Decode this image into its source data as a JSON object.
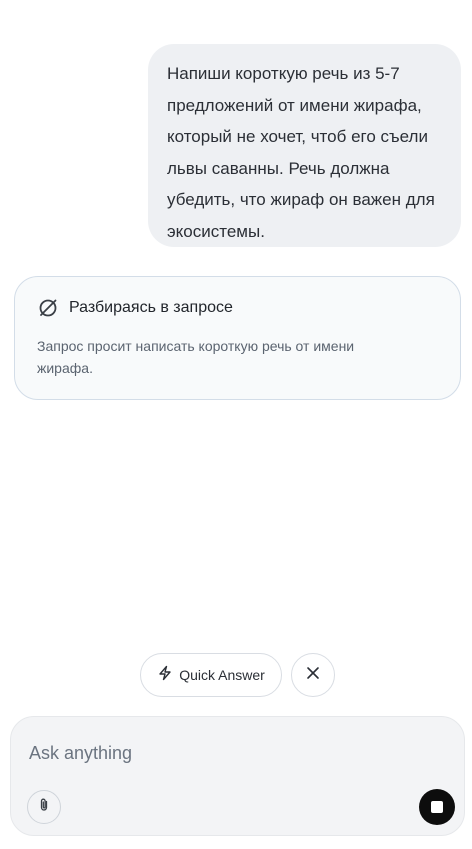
{
  "chat": {
    "user_message": "Напиши короткую речь из 5-7\nпредложений от имени жирафа,\nкоторый не хочет, чтоб его съели\nльвы саванны. Речь должна\nубедить, что жираф он важен для\nэкосистемы."
  },
  "reasoning": {
    "icon": "slashed-circle-icon",
    "title": "Разбираясь в запросе",
    "text": "Запрос просит написать короткую речь от имени\nжирафа."
  },
  "actions": {
    "quick_answer_label": "Quick Answer",
    "quick_answer_icon": "lightning-icon",
    "dismiss_icon": "close-icon"
  },
  "composer": {
    "placeholder": "Ask anything",
    "attach_icon": "paperclip-icon",
    "stop_icon": "stop-icon"
  },
  "colors": {
    "user_bubble": "#eef0f3",
    "card_border": "#d3dde8",
    "composer_bg": "#f3f4f6",
    "stop_button": "#0d0d0d"
  }
}
